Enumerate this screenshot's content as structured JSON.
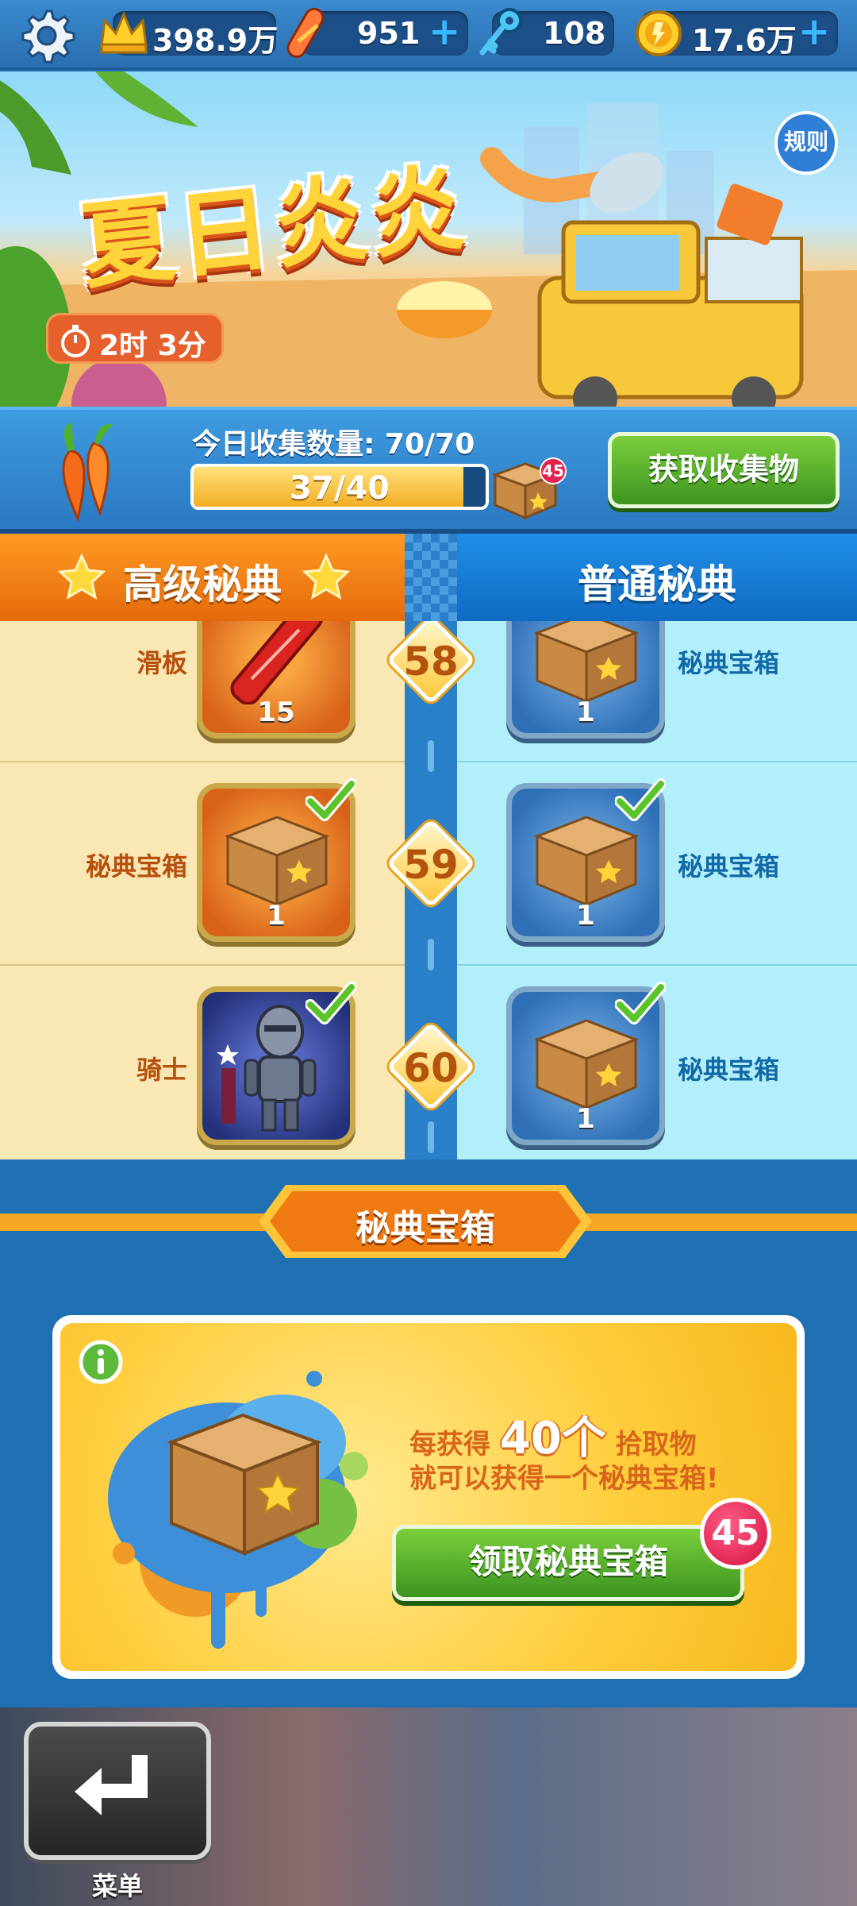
{
  "topbar": {
    "score": "398.9万",
    "boards": "951",
    "keys": "108",
    "coins": "17.6万"
  },
  "banner": {
    "title": "夏日炎炎",
    "timer": "2时 3分",
    "rules_label": "规则"
  },
  "collect": {
    "today_label": "今日收集数量: 70/70",
    "progress_text": "37/40",
    "progress_fraction": 0.925,
    "box_badge": "45",
    "get_button": "获取收集物"
  },
  "tabs": {
    "advanced": "高级秘典",
    "normal": "普通秘典"
  },
  "rows": [
    {
      "level": "58",
      "left_label": "滑板",
      "left_count": "15",
      "left_checked": false,
      "right_label": "秘典宝箱",
      "right_count": "1",
      "right_checked": false
    },
    {
      "level": "59",
      "left_label": "秘典宝箱",
      "left_count": "1",
      "left_checked": true,
      "right_label": "秘典宝箱",
      "right_count": "1",
      "right_checked": true
    },
    {
      "level": "60",
      "left_label": "骑士",
      "left_count": "",
      "left_checked": true,
      "right_label": "秘典宝箱",
      "right_count": "1",
      "right_checked": true
    }
  ],
  "treasure": {
    "title": "秘典宝箱",
    "line1_prefix": "每获得",
    "line1_big": "40个",
    "line1_suffix": "拾取物",
    "line2": "就可以获得一个秘典宝箱!",
    "claim_button": "领取秘典宝箱",
    "claim_badge": "45"
  },
  "bottom": {
    "menu_label": "菜单"
  },
  "colors": {
    "accent_orange": "#e56a0c",
    "accent_blue": "#0f6ac2",
    "button_green": "#3c9420",
    "badge_red": "#d4123f"
  }
}
